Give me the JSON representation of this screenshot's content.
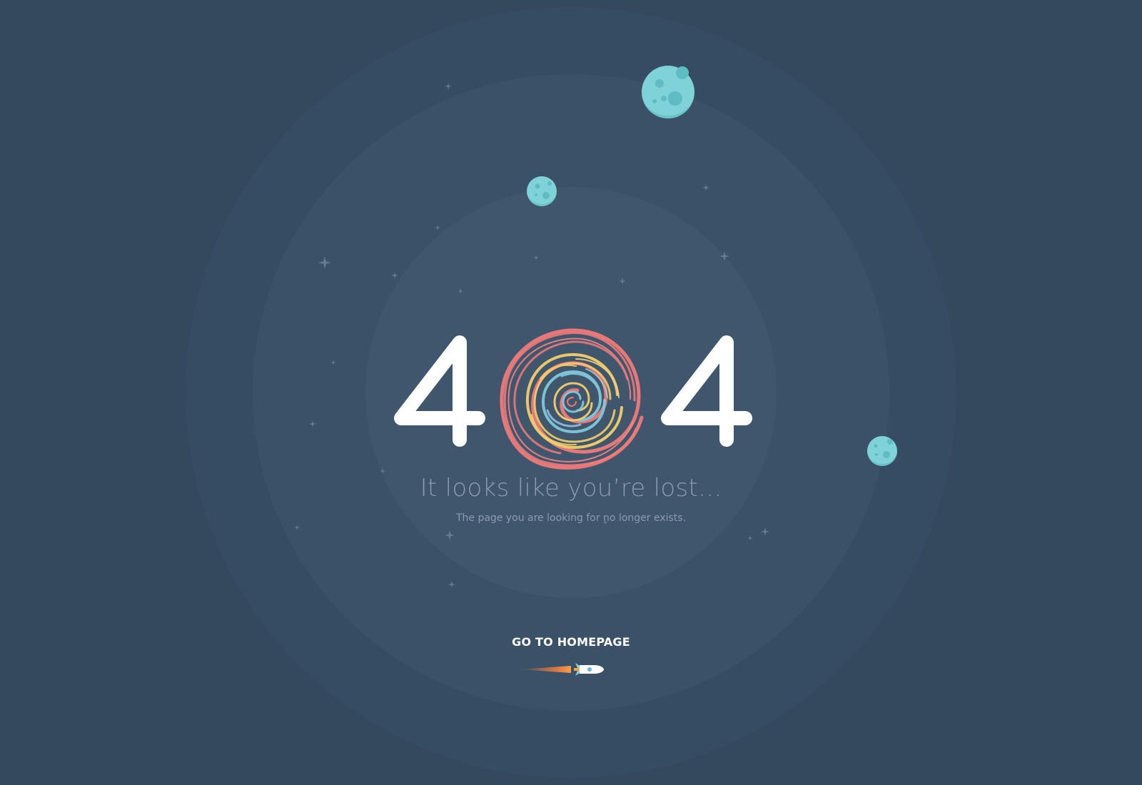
{
  "error": {
    "digit_left": "4",
    "digit_right": "4",
    "center_graphic": "swirl-galaxy-icon"
  },
  "message": {
    "headline": "It looks like you’re lost...",
    "subline": "The page you are looking for no longer exists."
  },
  "cta": {
    "label": "GO TO HOMEPAGE",
    "icon": "rocket-icon"
  },
  "decorations": {
    "planets": [
      "planet-large-icon",
      "planet-small-icon",
      "planet-right-icon"
    ],
    "star_icon": "star-icon"
  },
  "colors": {
    "background": "#34495e",
    "planet": "#7fd3d8",
    "text_muted": "#8a9bad",
    "text_primary": "#ffffff",
    "swirl_red": "#f07a7a",
    "swirl_yellow": "#f2cd6b",
    "swirl_teal": "#7fc8d8"
  }
}
